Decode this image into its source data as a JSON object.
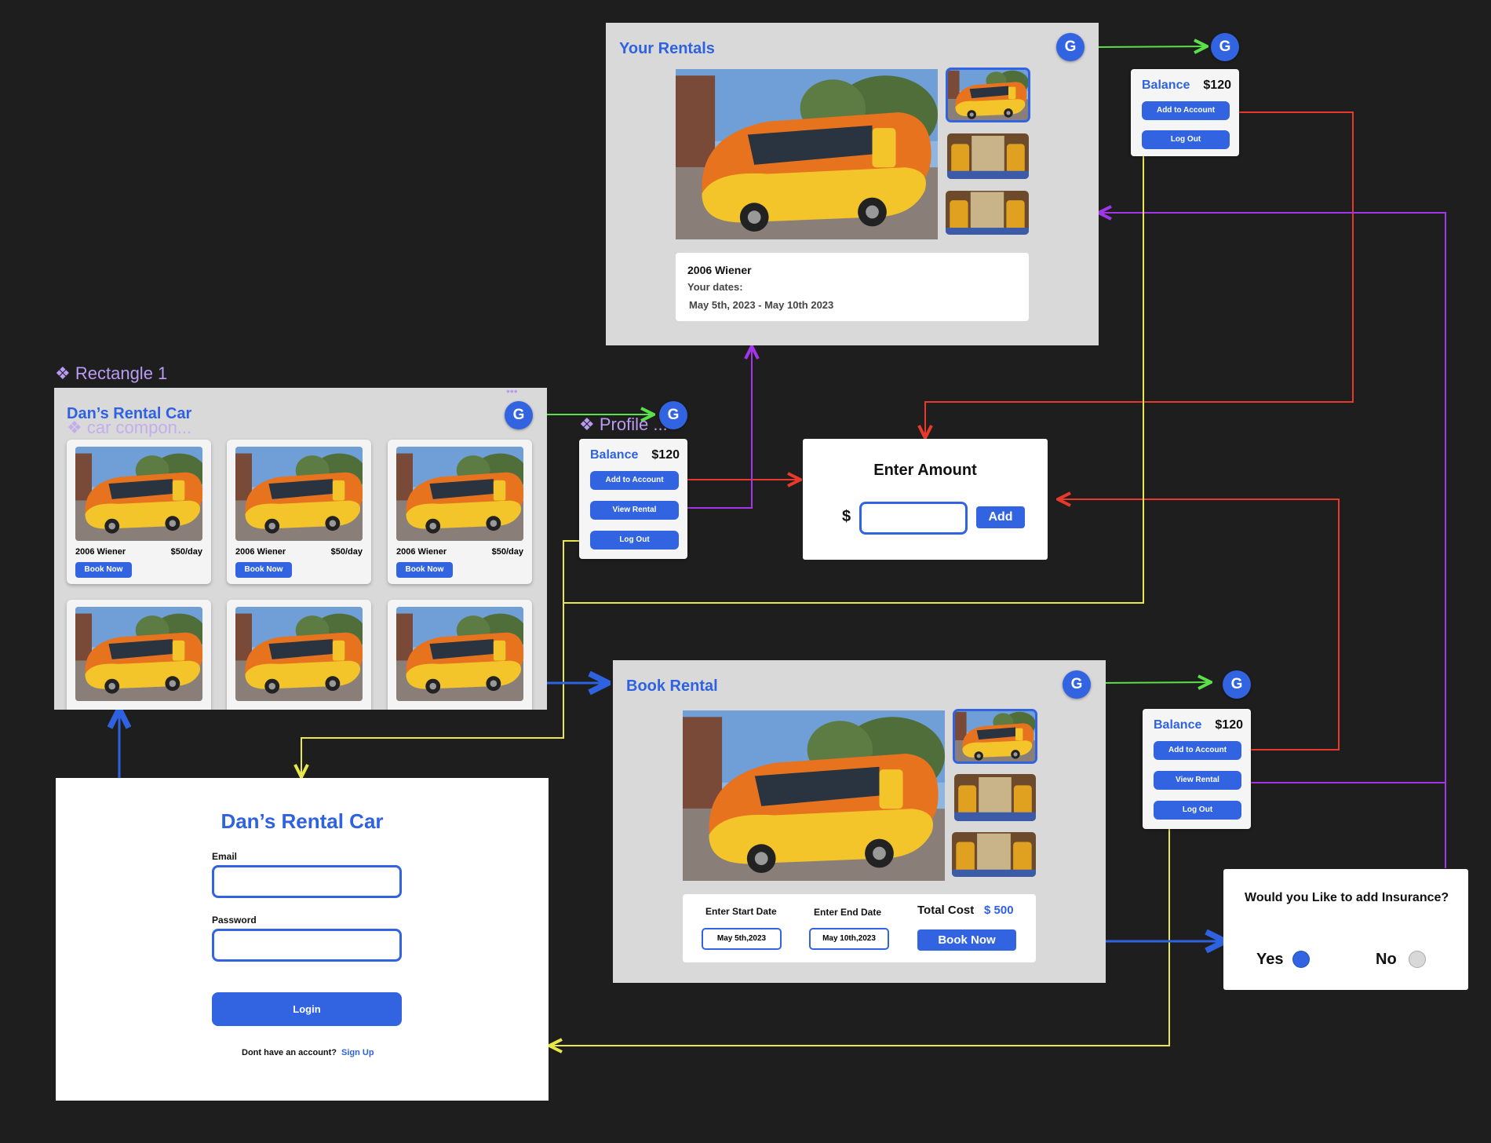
{
  "rentals": {
    "title": "Your Rentals",
    "avatar": "G",
    "car_name": "2006 Wiener",
    "dates_label": "Your dates:",
    "dates": "May 5th, 2023 - May 10th 2023"
  },
  "profile_panels": {
    "balance_label": "Balance",
    "balance_amount": "$120",
    "add_label": "Add to Account",
    "view_label": "View Rental",
    "logout_label": "Log Out"
  },
  "home": {
    "component_label": "Rectangle 1",
    "title": "Dan’s Rental Car",
    "car_component_label": "car compon...",
    "avatar": "G",
    "cars": [
      {
        "name": "2006 Wiener",
        "price": "$50/day",
        "button": "Book Now"
      },
      {
        "name": "2006 Wiener",
        "price": "$50/day",
        "button": "Book Now"
      },
      {
        "name": "2006 Wiener",
        "price": "$50/day",
        "button": "Book Now"
      },
      {
        "name": "",
        "price": "",
        "button": ""
      },
      {
        "name": "",
        "price": "",
        "button": ""
      },
      {
        "name": "",
        "price": "",
        "button": ""
      }
    ]
  },
  "profile_component_label": "Profile ...",
  "enter_amount": {
    "title": "Enter Amount",
    "currency": "$",
    "add_label": "Add"
  },
  "book": {
    "title": "Book Rental",
    "avatar": "G",
    "start_label": "Enter Start Date",
    "end_label": "Enter End Date",
    "start_value": "May 5th,2023",
    "end_value": "May 10th,2023",
    "total_label": "Total Cost",
    "total_value": "$ 500",
    "book_label": "Book Now"
  },
  "insurance": {
    "question": "Would you Like to add Insurance?",
    "yes": "Yes",
    "no": "No",
    "selected": "Yes"
  },
  "login": {
    "title": "Dan’s Rental Car",
    "email_label": "Email",
    "password_label": "Password",
    "login_label": "Login",
    "no_account": "Dont have an account?",
    "signup": "Sign Up"
  },
  "colors": {
    "brand_blue": "#3264e2",
    "flow_green": "#5be04a",
    "flow_red": "#e8392a",
    "flow_purple": "#a236e8",
    "flow_yellow": "#e8e84a",
    "flow_blue": "#2f62e0"
  }
}
